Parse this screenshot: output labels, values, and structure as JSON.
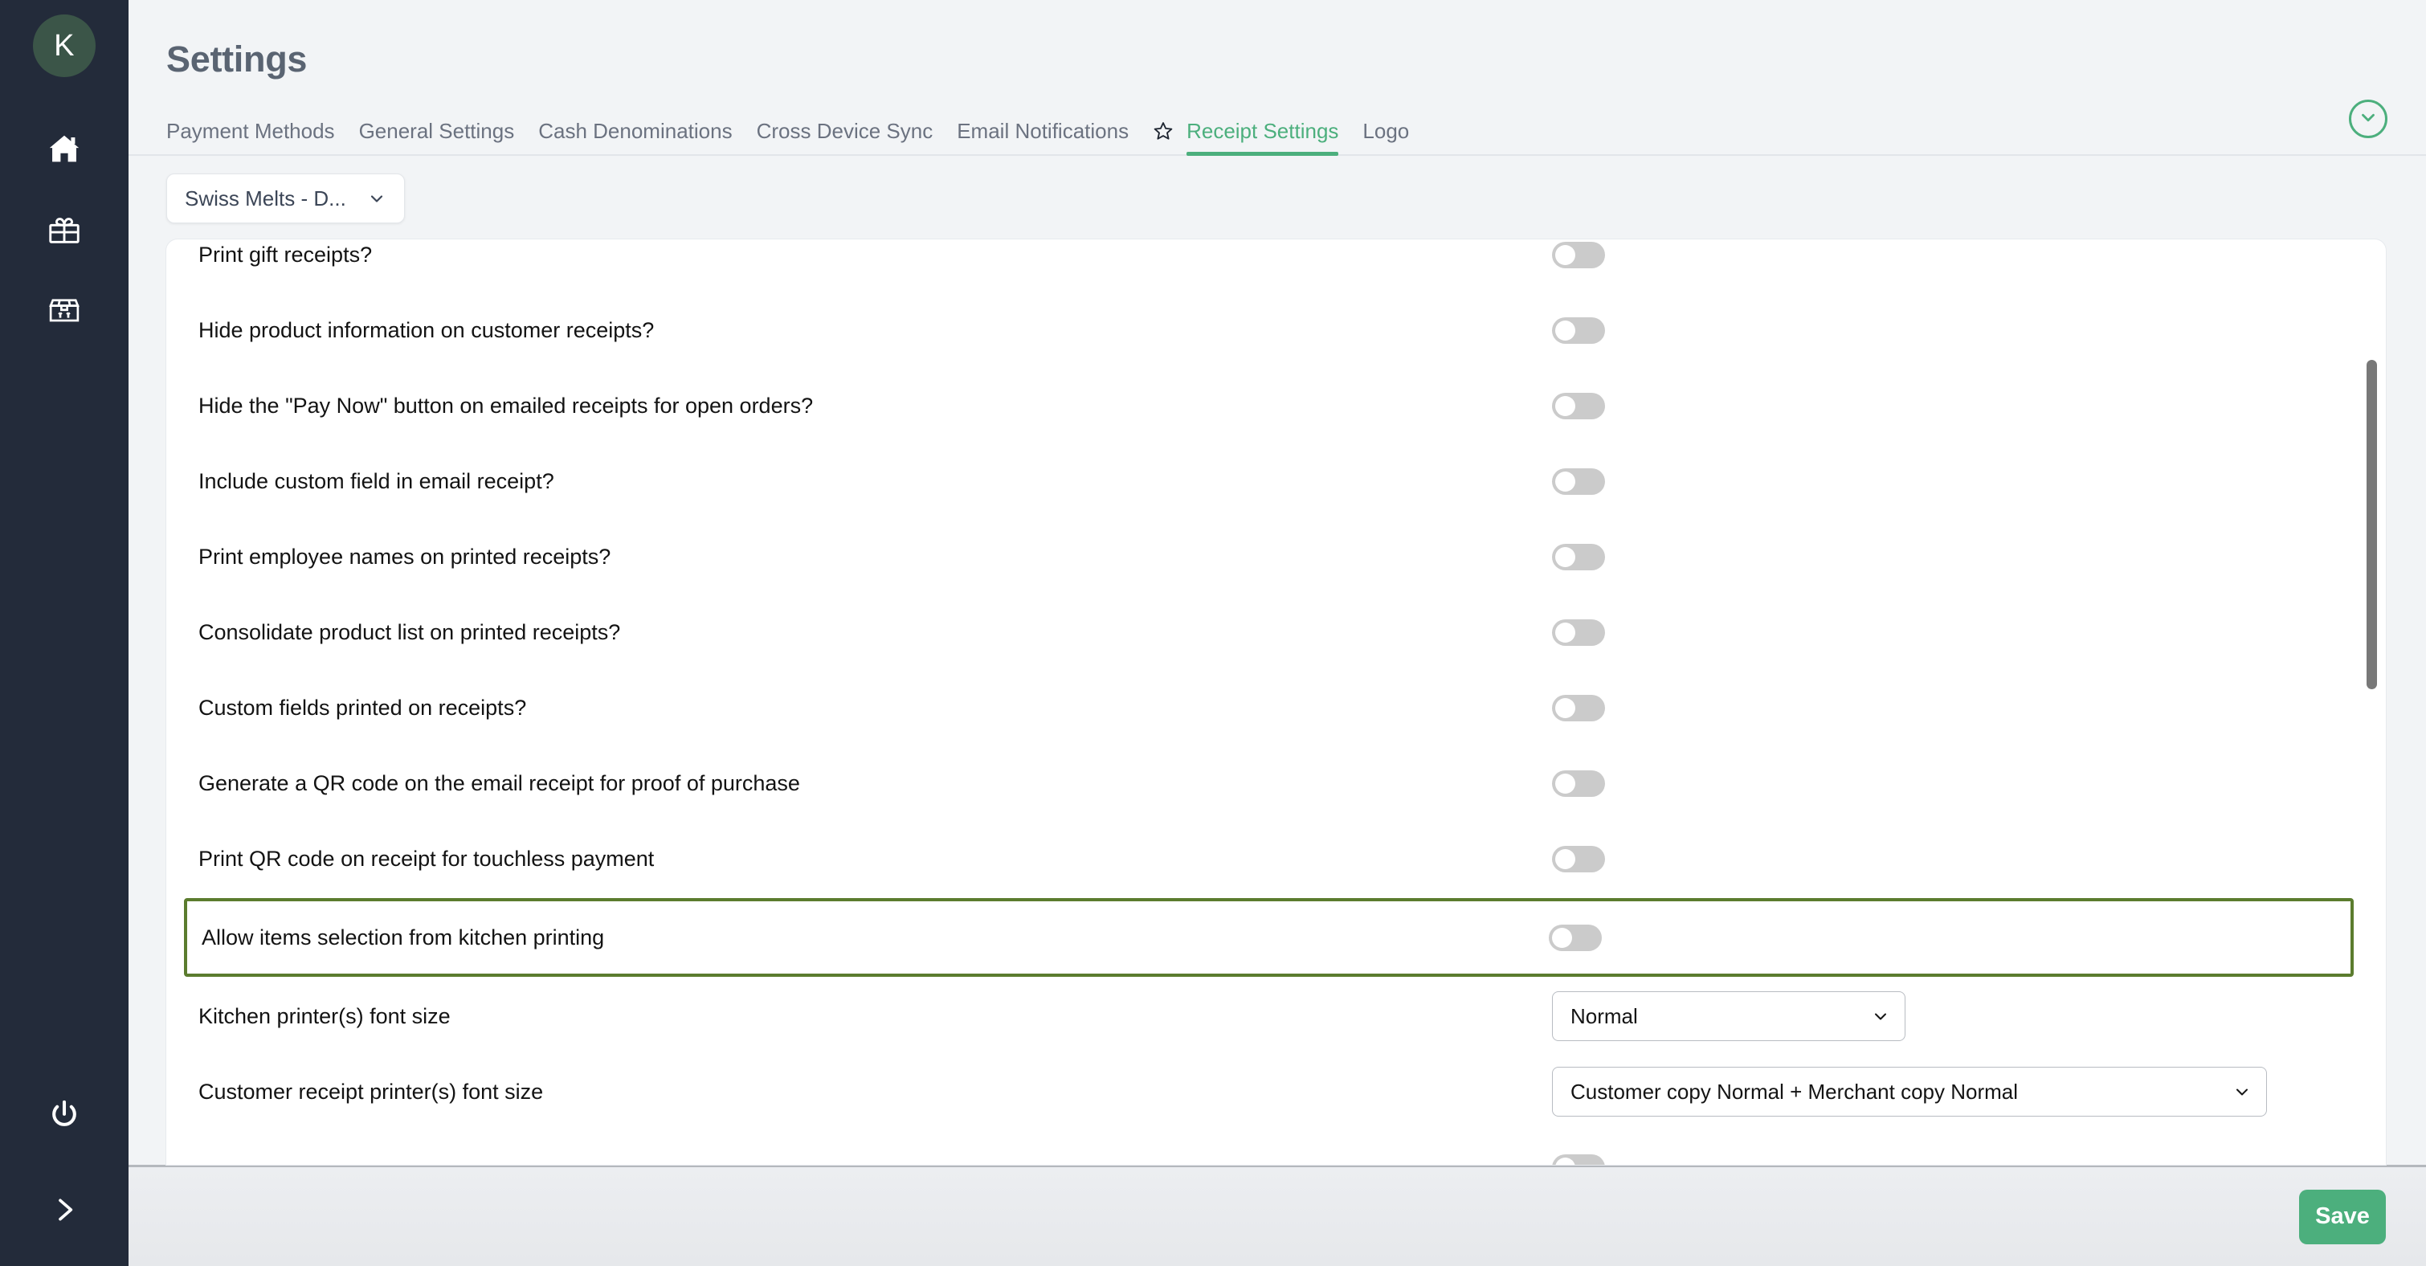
{
  "sidebar": {
    "avatar_initial": "K",
    "icons": [
      {
        "name": "home-icon"
      },
      {
        "name": "gift-icon"
      },
      {
        "name": "inventory-box-icon"
      }
    ],
    "bottom_icons": [
      {
        "name": "power-icon"
      },
      {
        "name": "expand-chevron-right-icon"
      }
    ]
  },
  "header": {
    "title": "Settings"
  },
  "tabs": [
    {
      "label": "Payment Methods",
      "active": false
    },
    {
      "label": "General Settings",
      "active": false
    },
    {
      "label": "Cash Denominations",
      "active": false
    },
    {
      "label": "Cross Device Sync",
      "active": false
    },
    {
      "label": "Email Notifications",
      "active": false
    },
    {
      "label": "Receipt Settings",
      "active": true
    },
    {
      "label": "Logo",
      "active": false
    }
  ],
  "store_selector": {
    "value": "Swiss Melts - D...",
    "icon": "chevron-down-icon"
  },
  "settings_rows": [
    {
      "label": "Print gift receipts?",
      "control": "toggle",
      "value": "off",
      "clipped": true
    },
    {
      "label": "Hide product information on customer receipts?",
      "control": "toggle",
      "value": "off"
    },
    {
      "label": "Hide the \"Pay Now\" button on emailed receipts for open orders?",
      "control": "toggle",
      "value": "off"
    },
    {
      "label": "Include custom field in email receipt?",
      "control": "toggle",
      "value": "off"
    },
    {
      "label": "Print employee names on printed receipts?",
      "control": "toggle",
      "value": "off"
    },
    {
      "label": "Consolidate product list on printed receipts?",
      "control": "toggle",
      "value": "off"
    },
    {
      "label": "Custom fields printed on receipts?",
      "control": "toggle",
      "value": "off"
    },
    {
      "label": "Generate a QR code on the email receipt for proof of purchase",
      "control": "toggle",
      "value": "off"
    },
    {
      "label": "Print QR code on receipt for touchless payment",
      "control": "toggle",
      "value": "off"
    },
    {
      "label": "Allow items selection from kitchen printing",
      "control": "toggle",
      "value": "off",
      "highlighted": true
    },
    {
      "label": "Kitchen printer(s) font size",
      "control": "select",
      "value": "Normal"
    },
    {
      "label": "Customer receipt printer(s) font size",
      "control": "select",
      "value": "Customer copy Normal + Merchant copy Normal"
    }
  ],
  "footer": {
    "save_label": "Save"
  },
  "colors": {
    "accent_green": "#4caf7d",
    "highlight_border": "#5b7c2e",
    "sidebar_bg": "#232b3a",
    "avatar_bg": "#3b5548",
    "page_bg": "#f2f4f6"
  }
}
